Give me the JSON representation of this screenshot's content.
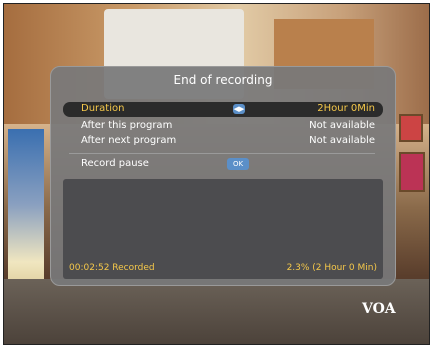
{
  "dialog": {
    "title": "End of recording",
    "rows": [
      {
        "label": "Duration",
        "value": "2Hour 0Min",
        "selected": true
      },
      {
        "label": "After this program",
        "value": "Not available"
      },
      {
        "label": "After next program",
        "value": "Not available"
      },
      {
        "label": "Record pause",
        "button": "OK"
      }
    ],
    "status": {
      "recorded": "00:02:52 Recorded",
      "progress": "2.3% (2 Hour 0 Min)"
    }
  },
  "watermark": "VOA",
  "colors": {
    "dialog_bg": "#78787a",
    "highlight_text": "#f5c84a",
    "button": "#5b8fc8"
  }
}
